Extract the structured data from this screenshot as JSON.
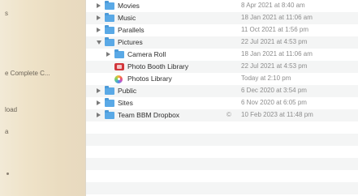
{
  "sidebar": {
    "items": [
      {
        "label": "s"
      },
      {
        "label": "e Complete C..."
      },
      {
        "label": "load"
      },
      {
        "label": "a"
      }
    ]
  },
  "files": [
    {
      "name": "Movies",
      "date": "8 Apr 2021 at 8:40 am",
      "kind": "folder",
      "expanded": false,
      "level": 0
    },
    {
      "name": "Music",
      "date": "18 Jan 2021 at 11:06 am",
      "kind": "folder",
      "expanded": false,
      "level": 0
    },
    {
      "name": "Parallels",
      "date": "11 Oct 2021 at 1:56 pm",
      "kind": "folder",
      "expanded": false,
      "level": 0
    },
    {
      "name": "Pictures",
      "date": "22 Jul 2021 at 4:53 pm",
      "kind": "folder",
      "expanded": true,
      "level": 0
    },
    {
      "name": "Camera Roll",
      "date": "18 Jan 2021 at 11:06 am",
      "kind": "folder",
      "expanded": false,
      "level": 1
    },
    {
      "name": "Photo Booth Library",
      "date": "22 Jul 2021 at 4:53 pm",
      "kind": "booth",
      "expanded": false,
      "level": 1
    },
    {
      "name": "Photos Library",
      "date": "Today at 2:10 pm",
      "kind": "photos",
      "expanded": false,
      "level": 1
    },
    {
      "name": "Public",
      "date": "6 Dec 2020 at 3:54 pm",
      "kind": "folder",
      "expanded": false,
      "level": 0
    },
    {
      "name": "Sites",
      "date": "6 Nov 2020 at 6:05 pm",
      "kind": "folder",
      "expanded": false,
      "level": 0
    },
    {
      "name": "Team BBM Dropbox",
      "date": "10 Feb 2023 at 11:48 pm",
      "kind": "folder",
      "expanded": false,
      "level": 0,
      "cloud": "©"
    }
  ]
}
